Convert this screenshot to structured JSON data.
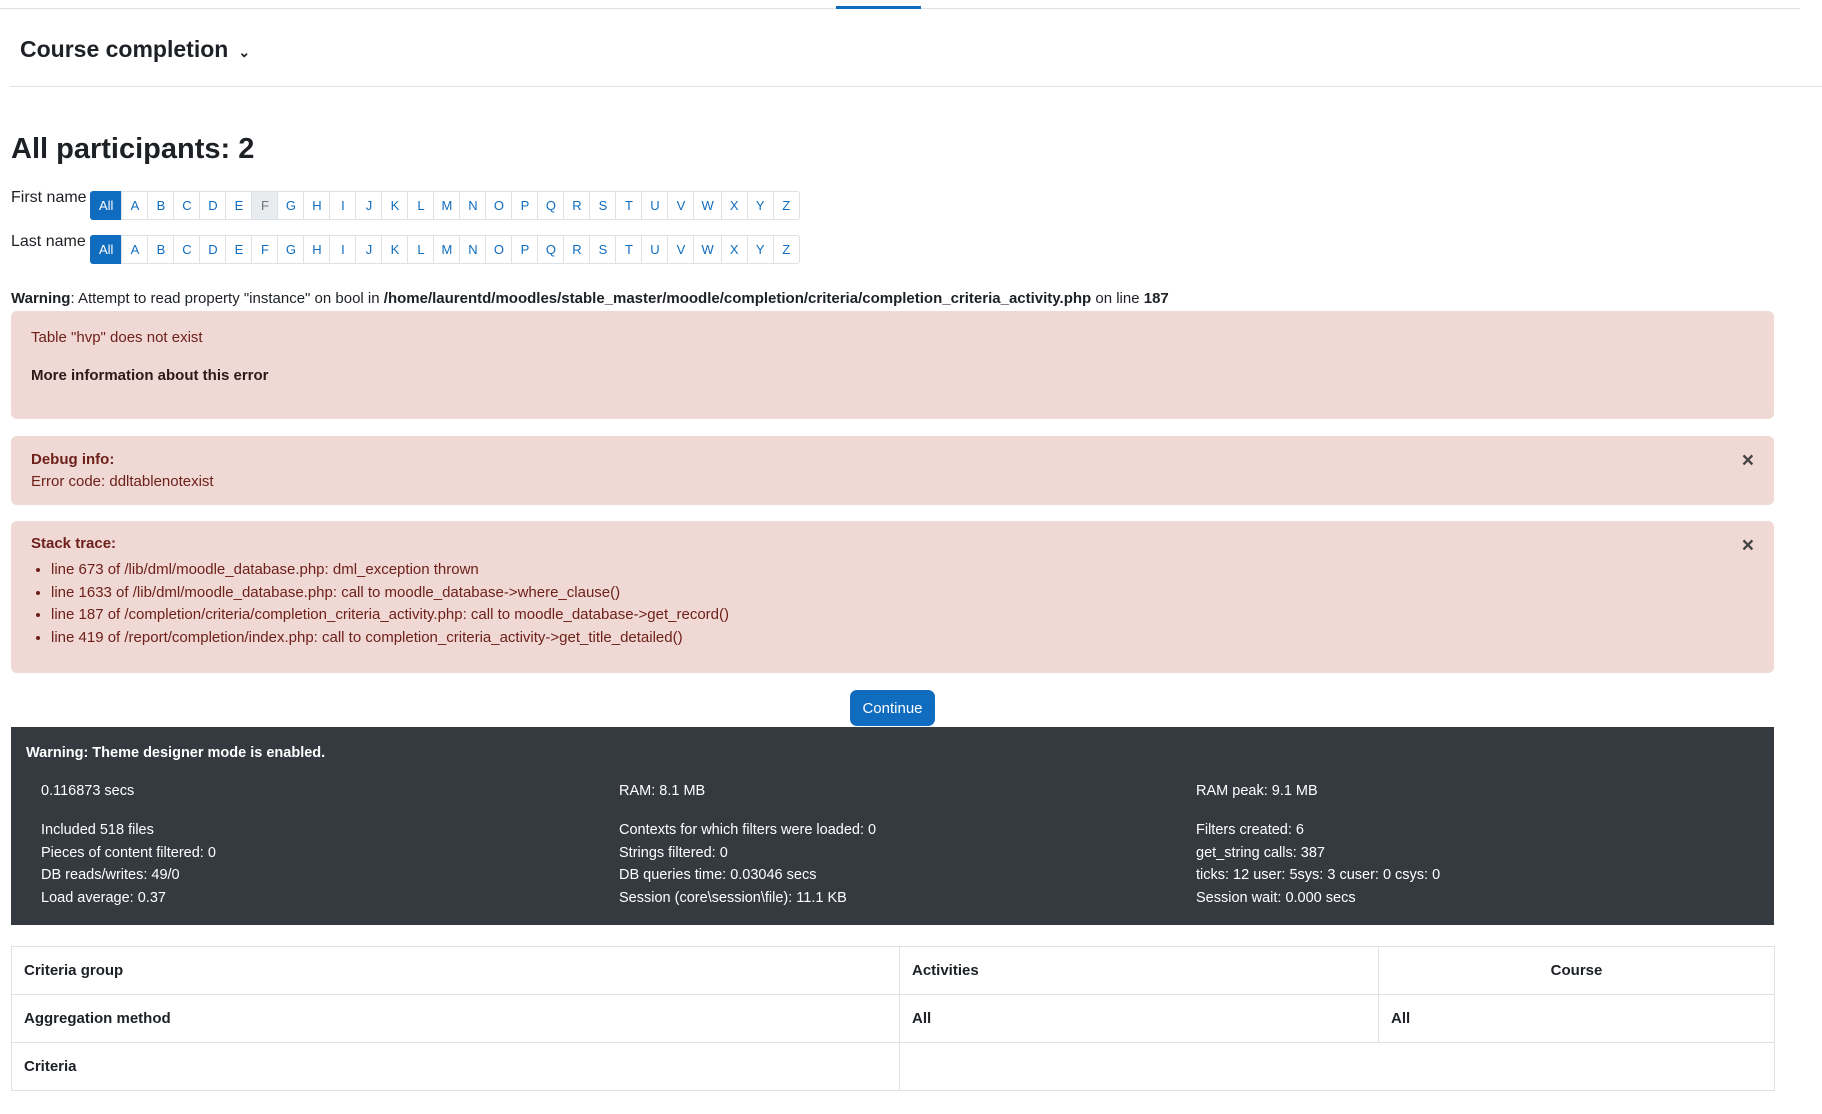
{
  "header": {
    "title": "Course completion",
    "title_icon": "chevron-down-icon"
  },
  "participants": {
    "heading": "All participants: 2"
  },
  "initials": {
    "first_label": "First name",
    "last_label": "Last name",
    "letters": [
      "All",
      "A",
      "B",
      "C",
      "D",
      "E",
      "F",
      "G",
      "H",
      "I",
      "J",
      "K",
      "L",
      "M",
      "N",
      "O",
      "P",
      "Q",
      "R",
      "S",
      "T",
      "U",
      "V",
      "W",
      "X",
      "Y",
      "Z"
    ],
    "first_selected": "All",
    "first_hover": "F",
    "last_selected": "All"
  },
  "warning": {
    "label": "Warning",
    "text_before": ": Attempt to read property \"instance\" on bool in ",
    "path": "/home/laurentd/moodles/stable_master/moodle/completion/criteria/completion_criteria_activity.php",
    "text_mid": " on line ",
    "line": "187"
  },
  "error": {
    "message": "Table \"hvp\" does not exist",
    "more_info": "More information about this error"
  },
  "debug": {
    "title": "Debug info:",
    "code": "Error code: ddltablenotexist",
    "close_icon": "close-icon"
  },
  "stack": {
    "title": "Stack trace:",
    "items": [
      "line 673 of /lib/dml/moodle_database.php: dml_exception thrown",
      "line 1633 of /lib/dml/moodle_database.php: call to moodle_database->where_clause()",
      "line 187 of /completion/criteria/completion_criteria_activity.php: call to moodle_database->get_record()",
      "line 419 of /report/completion/index.php: call to completion_criteria_activity->get_title_detailed()"
    ]
  },
  "continue_label": "Continue",
  "perf": {
    "warning": "Warning: Theme designer mode is enabled.",
    "col1_top": "0.116873 secs",
    "col2_top": "RAM: 8.1 MB",
    "col3_top": "RAM peak: 9.1 MB",
    "col1": [
      "Included 518 files",
      "Pieces of content filtered: 0",
      "DB reads/writes: 49/0",
      "Load average: 0.37"
    ],
    "col2": [
      "Contexts for which filters were loaded: 0",
      "Strings filtered: 0",
      "DB queries time: 0.03046 secs",
      "Session (core\\session\\file): 11.1 KB"
    ],
    "col3": [
      "Filters created: 6",
      "get_string calls: 387",
      "ticks: 12 user: 5sys: 3 cuser: 0 csys: 0",
      "Session wait: 0.000 secs"
    ]
  },
  "criteria_table": {
    "row1": [
      "Criteria group",
      "Activities",
      "Course"
    ],
    "row2": [
      "Aggregation method",
      "All",
      "All"
    ],
    "row3": [
      "Criteria",
      "",
      ""
    ]
  },
  "colors": {
    "primary": "#0f6cbf",
    "alert_bg": "#f0d8d5",
    "alert_text": "#6e211a",
    "perf_bg": "#343a40"
  }
}
